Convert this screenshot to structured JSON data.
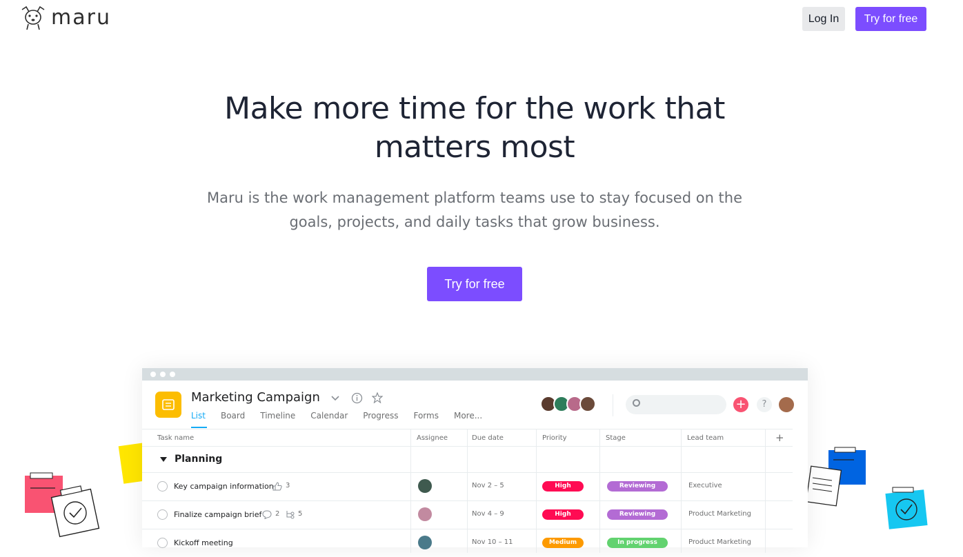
{
  "nav": {
    "brand": "maru",
    "login_label": "Log In",
    "try_label": "Try for free"
  },
  "hero": {
    "headline_line1": "Make more time for the work that",
    "headline_line2": "matters most",
    "sub_line1": "Maru is the work management platform teams use to stay focused on the",
    "sub_line2": "goals, projects, and daily tasks that grow business.",
    "cta_label": "Try for free"
  },
  "app": {
    "project_title": "Marketing Campaign",
    "tabs": [
      "List",
      "Board",
      "Timeline",
      "Calendar",
      "Progress",
      "Forms",
      "More..."
    ],
    "active_tab": "List",
    "columns": [
      "Task name",
      "Assignee",
      "Due date",
      "Priority",
      "Stage",
      "Lead team"
    ],
    "add_column": "+",
    "section": "Planning",
    "rows": [
      {
        "name": "Key campaign information",
        "likes": "3",
        "comments": "",
        "subtasks": "",
        "due": "Nov 2 – 5",
        "priority": "High",
        "stage": "Reviewing",
        "lead": "Executive"
      },
      {
        "name": "Finalize campaign brief",
        "likes": "",
        "comments": "2",
        "subtasks": "5",
        "due": "Nov 4 – 9",
        "priority": "High",
        "stage": "Reviewing",
        "lead": "Product Marketing"
      },
      {
        "name": "Kickoff meeting",
        "likes": "",
        "comments": "",
        "subtasks": "",
        "due": "Nov 10 – 11",
        "priority": "Medium",
        "stage": "In progress",
        "lead": "Product Marketing"
      }
    ]
  },
  "colors": {
    "accent": "#7c4dff",
    "high": "#ff0b53",
    "medium": "#fd9a00",
    "reviewing": "#b36bd4",
    "in_progress": "#62d26f",
    "project_icon": "#fcbd01"
  },
  "icons": [
    "dog-logo-icon",
    "chevron-down-icon",
    "info-icon",
    "star-icon",
    "search-icon",
    "plus-icon",
    "help-icon",
    "thumbs-up-icon",
    "comment-icon",
    "subtask-icon",
    "checkbox-icon",
    "triangle-down-icon"
  ]
}
